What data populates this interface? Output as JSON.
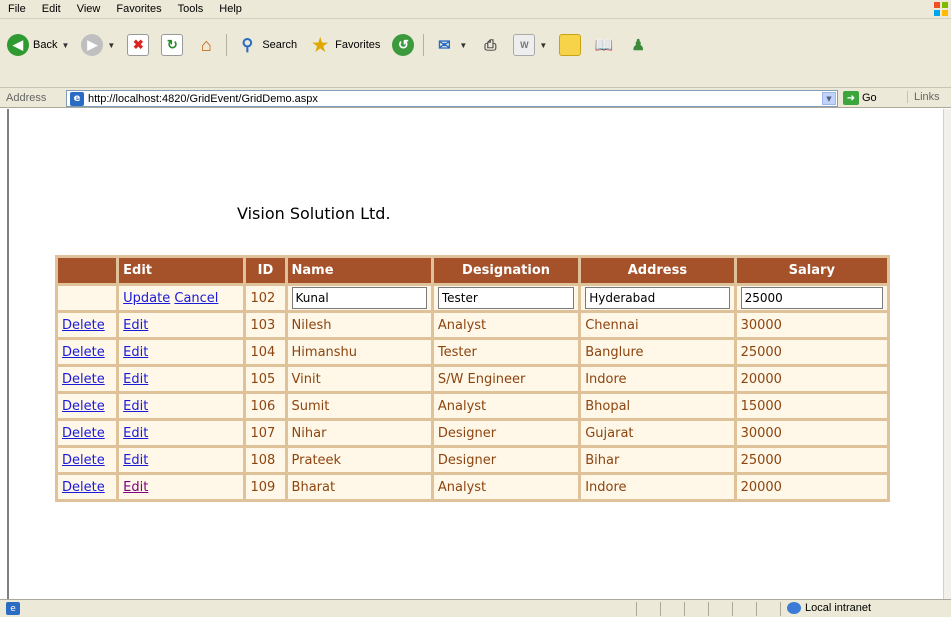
{
  "menu": [
    "File",
    "Edit",
    "View",
    "Favorites",
    "Tools",
    "Help"
  ],
  "toolbar": {
    "back_label": "Back",
    "search_label": "Search",
    "favorites_label": "Favorites"
  },
  "address": {
    "label": "Address",
    "url": "http://localhost:4820/GridEvent/GridDemo.aspx",
    "go_label": "Go",
    "links_label": "Links"
  },
  "page": {
    "company": "Vision Solution Ltd."
  },
  "grid": {
    "headers": [
      "",
      "Edit",
      "ID",
      "Name",
      "Designation",
      "Address",
      "Salary"
    ],
    "edit_row": {
      "update_label": "Update",
      "cancel_label": "Cancel",
      "id": "102",
      "name": "Kunal",
      "designation": "Tester",
      "address": "Hyderabad",
      "salary": "25000"
    },
    "rows": [
      {
        "delete": "Delete",
        "edit": "Edit",
        "id": "103",
        "name": "Nilesh",
        "designation": "Analyst",
        "address": "Chennai",
        "salary": "30000"
      },
      {
        "delete": "Delete",
        "edit": "Edit",
        "id": "104",
        "name": "Himanshu",
        "designation": "Tester",
        "address": "Banglure",
        "salary": "25000"
      },
      {
        "delete": "Delete",
        "edit": "Edit",
        "id": "105",
        "name": "Vinit",
        "designation": "S/W Engineer",
        "address": "Indore",
        "salary": "20000"
      },
      {
        "delete": "Delete",
        "edit": "Edit",
        "id": "106",
        "name": "Sumit",
        "designation": "Analyst",
        "address": "Bhopal",
        "salary": "15000"
      },
      {
        "delete": "Delete",
        "edit": "Edit",
        "id": "107",
        "name": "Nihar",
        "designation": "Designer",
        "address": "Gujarat",
        "salary": "30000"
      },
      {
        "delete": "Delete",
        "edit": "Edit",
        "id": "108",
        "name": "Prateek",
        "designation": "Designer",
        "address": "Bihar",
        "salary": "25000"
      },
      {
        "delete": "Delete",
        "edit": "Edit",
        "id": "109",
        "name": "Bharat",
        "designation": "Analyst",
        "address": "Indore",
        "salary": "20000"
      }
    ]
  },
  "status": {
    "zone": "Local intranet"
  },
  "colors": {
    "header_bg": "#a55129",
    "cell_bg": "#fff7e7",
    "cell_text": "#8c4510",
    "grid_border": "#dfc29a"
  }
}
